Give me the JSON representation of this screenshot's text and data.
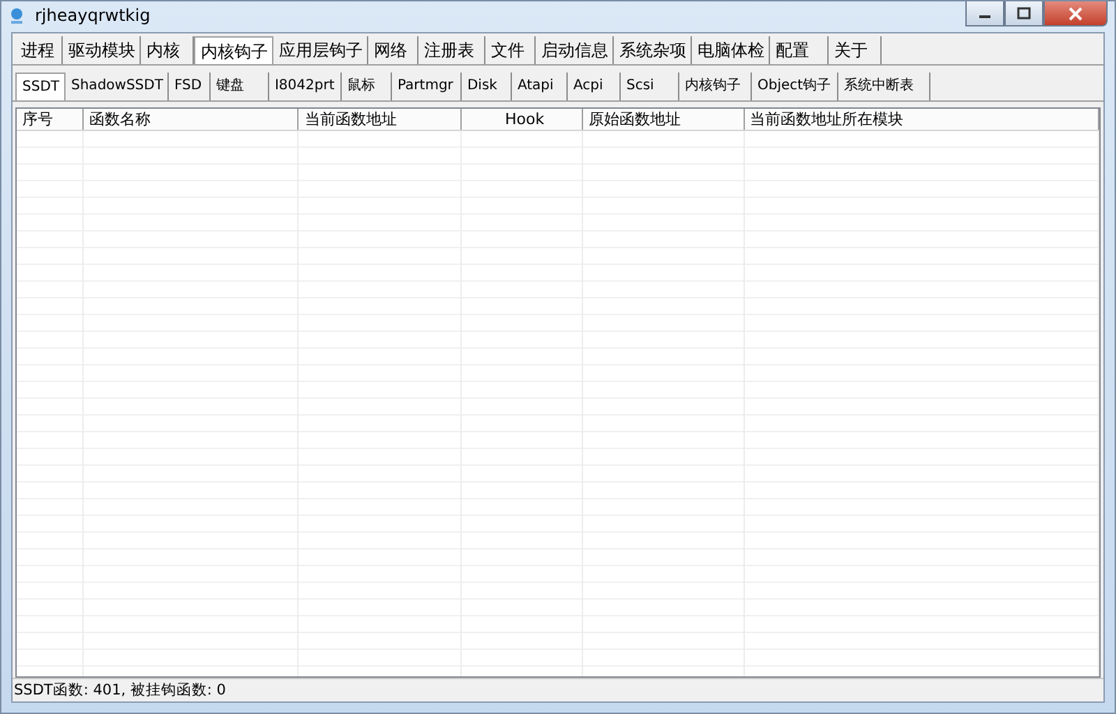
{
  "window": {
    "title": "rjheayqrwtkig"
  },
  "tabs": [
    {
      "label": "进程",
      "selected": false
    },
    {
      "label": "驱动模块",
      "selected": false
    },
    {
      "label": "内核",
      "selected": false
    },
    {
      "label": "内核钩子",
      "selected": true
    },
    {
      "label": "应用层钩子",
      "selected": false
    },
    {
      "label": "网络",
      "selected": false
    },
    {
      "label": "注册表",
      "selected": false
    },
    {
      "label": "文件",
      "selected": false
    },
    {
      "label": "启动信息",
      "selected": false
    },
    {
      "label": "系统杂项",
      "selected": false
    },
    {
      "label": "电脑体检",
      "selected": false
    },
    {
      "label": "配置",
      "selected": false
    },
    {
      "label": "关于",
      "selected": false
    }
  ],
  "sub_tabs": [
    {
      "label": "SSDT",
      "selected": true
    },
    {
      "label": "ShadowSSDT",
      "selected": false
    },
    {
      "label": "FSD",
      "selected": false
    },
    {
      "label": "键盘",
      "selected": false
    },
    {
      "label": "I8042prt",
      "selected": false
    },
    {
      "label": "鼠标",
      "selected": false
    },
    {
      "label": "Partmgr",
      "selected": false
    },
    {
      "label": "Disk",
      "selected": false
    },
    {
      "label": "Atapi",
      "selected": false
    },
    {
      "label": "Acpi",
      "selected": false
    },
    {
      "label": "Scsi",
      "selected": false
    },
    {
      "label": "内核钩子",
      "selected": false
    },
    {
      "label": "Object钩子",
      "selected": false
    },
    {
      "label": "系统中断表",
      "selected": false
    }
  ],
  "table": {
    "columns": [
      {
        "label": "序号"
      },
      {
        "label": "函数名称"
      },
      {
        "label": "当前函数地址"
      },
      {
        "label": "Hook"
      },
      {
        "label": "原始函数地址"
      },
      {
        "label": "当前函数地址所在模块"
      }
    ]
  },
  "status_bar": "SSDT函数: 401, 被挂钩函数: 0"
}
